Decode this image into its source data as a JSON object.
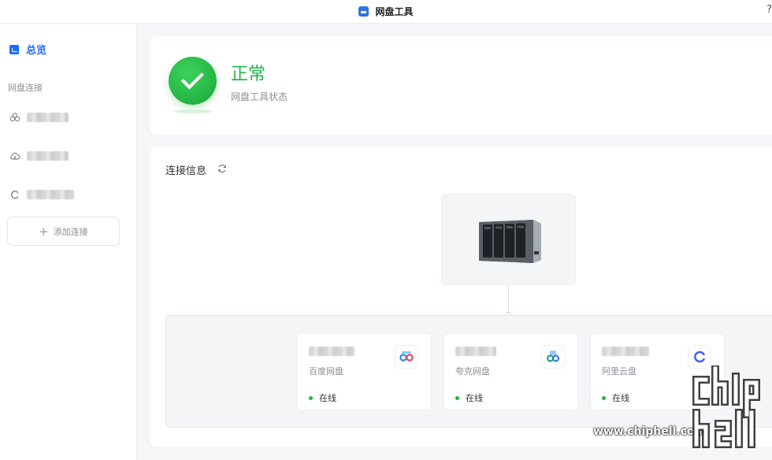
{
  "window": {
    "title": "网盘工具",
    "help": "?"
  },
  "sidebar": {
    "overview_label": "总览",
    "section_label": "网盘连接",
    "connections": [
      {
        "icon": "baidu-cloud-icon",
        "name_redacted": true
      },
      {
        "icon": "cloud-icon",
        "name_redacted": true
      },
      {
        "icon": "aliyun-icon",
        "name_redacted": true
      }
    ],
    "add_label": "添加连接"
  },
  "status": {
    "title": "正常",
    "subtitle": "网盘工具状态"
  },
  "connection_info": {
    "title": "连接信息",
    "drives": [
      {
        "provider": "百度网盘",
        "status": "在线",
        "logo": "baidu-netdisk-icon"
      },
      {
        "provider": "夸克网盘",
        "status": "在线",
        "logo": "quark-netdisk-icon"
      },
      {
        "provider": "阿里云盘",
        "status": "在线",
        "logo": "aliyun-drive-icon"
      }
    ]
  },
  "watermark": {
    "url": "www.chiphell.com",
    "logo_text": "chiphell"
  },
  "colors": {
    "accent": "#1f6bff",
    "ok": "#22b34a",
    "online": "#1fb34a"
  }
}
